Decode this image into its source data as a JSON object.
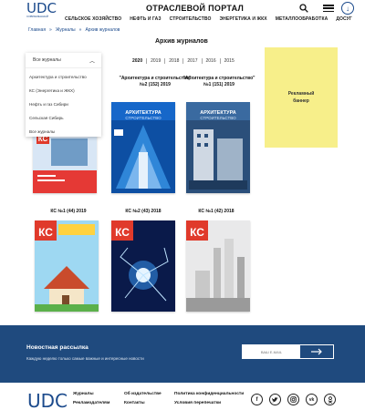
{
  "header": {
    "logo": "UDC",
    "logo_sub": "СОВРЕМЕННЫЙ",
    "portal_title": "ОТРАСЛЕВОЙ ПОРТАЛ",
    "nav": [
      "СЕЛЬСКОЕ ХОЗЯЙСТВО",
      "НЕФТЬ И ГАЗ",
      "СТРОИТЕЛЬСТВО",
      "ЭНЕРГЕТИКА И ЖКХ",
      "МЕТАЛЛООБРАБОТКА",
      "ДОСУГ"
    ]
  },
  "breadcrumb": [
    "Главная",
    "Журналы",
    "Архив журналов"
  ],
  "archive_title": "Архив журналов",
  "years": [
    "2020",
    "2019",
    "2018",
    "2017",
    "2016",
    "2015"
  ],
  "active_year": "2020",
  "dropdown": {
    "selected": "Все журналы",
    "items": [
      "Архитектура и строительство",
      "КС (Энергетика и ЖКХ)",
      "Нефть и газ Сибири",
      "Сельская Сибирь",
      "Все журналы"
    ]
  },
  "banner": {
    "line1": "Рекламный",
    "line2": "баннер"
  },
  "magazines": [
    {
      "label": ""
    },
    {
      "label": "\"Архитектура и строительство\" №2 (152) 2019"
    },
    {
      "label": "\"Архитектура и строительство\" №1 (151) 2019"
    },
    {
      "label": "КС №1 (44) 2019"
    },
    {
      "label": "КС №2 (43) 2018"
    },
    {
      "label": "КС №1 (42) 2018"
    }
  ],
  "cover_text": {
    "ks": "КС",
    "arch": "АРХИТЕКТУРА СТРОИТЕЛЬСТВО"
  },
  "newsletter": {
    "title": "Новостная рассылка",
    "subtitle": "Каждую неделю только самые важные и интересные новости",
    "placeholder": "ВАШ E-MAIL"
  },
  "footer": {
    "logo": "UDC",
    "col1": [
      "Журналы",
      "Рекламодателям"
    ],
    "col2": [
      "Об издательстве",
      "Контакты"
    ],
    "col3": [
      "Политика конфиденциальности",
      "Условия перепечатки"
    ],
    "socials": [
      "facebook-icon",
      "twitter-icon",
      "instagram-icon",
      "vk-icon",
      "odnoklassniki-icon"
    ]
  },
  "colors": {
    "brand": "#1b4a8c",
    "newsletter_bg": "#1f4a7e",
    "banner_bg": "#f7ef8a",
    "ks_red": "#e03a2b"
  }
}
